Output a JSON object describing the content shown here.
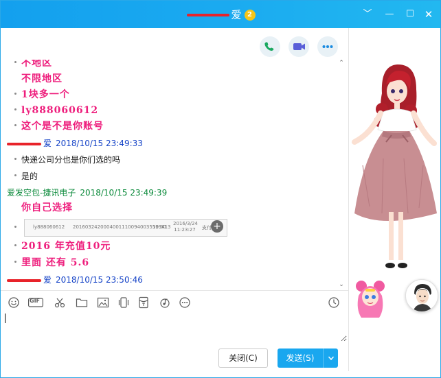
{
  "window": {
    "title_suffix": "爱",
    "vip_badge": "2",
    "accent_color": "#1aaaf0",
    "controls": {
      "collapse": "﹀",
      "minimize": "—",
      "maximize": "☐",
      "close": "✕"
    }
  },
  "header_actions": {
    "call": "phone-icon",
    "video": "video-camera-icon",
    "more": "more-icon"
  },
  "messages": {
    "l1": "不地区",
    "l2": "不限地区",
    "l3": "1块多一个",
    "l4": "ly888060612",
    "l5": "这个是不是你账号",
    "s1_name": "爱",
    "s1_time": "2018/10/15 23:49:33",
    "l6": "快递公司分也是你们选的吗",
    "l7": "是的",
    "s2_name": "爱发空包-捷讯电子",
    "s2_time": "2018/10/15 23:49:39",
    "l8": "你自己选择",
    "img_cells": [
      "ly888060612",
      "20160324200040011100940035599413",
      "10.00",
      "2016/3/24 11:23:27",
      "支付"
    ],
    "l9": "2016 年充值10元",
    "l10": "里面 还有 5.6",
    "s3_name": "爱",
    "s3_time": "2018/10/15 23:50:46"
  },
  "toolbar": {
    "gif": "GIF"
  },
  "buttons": {
    "close": "关闭(C)",
    "send": "发送(S)"
  },
  "colors": {
    "pink_text": "#ee1f7d",
    "sender_blue": "#1543c7",
    "sender_green": "#0b8a3b",
    "send_button": "#19a7ef"
  }
}
